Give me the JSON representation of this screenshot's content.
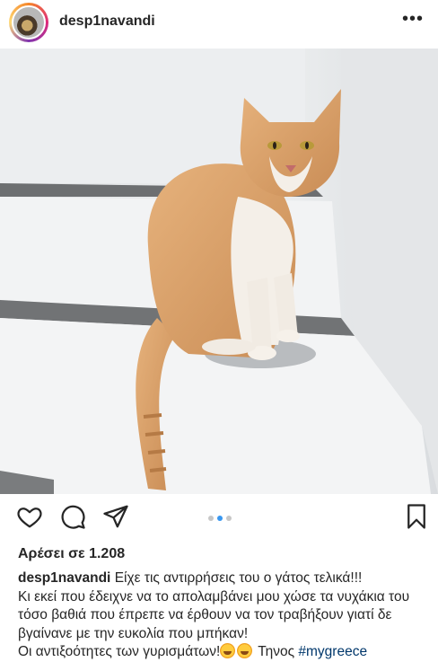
{
  "post": {
    "username": "desp1navandi",
    "more_icon_glyph": "•••",
    "likes_text": "Αρέσει σε 1.208",
    "carousel": {
      "count": 3,
      "active_index": 1
    },
    "caption": {
      "username": "desp1navandi",
      "line1": "Είχε τις αντιρρήσεις του ο γάτος τελικά!!!",
      "line2": "Κι εκεί που έδειχνε να το απολαμβάνει μου χώσε τα νυχάκια του τόσο βαθιά που έπρεπε να έρθουν να τον τραβήξουν γιατί δε βγαίνανε με την ευκολία που μπήκαν!",
      "line3_text": "Οι αντιξοότητες των γυρισμάτων!",
      "emoji": [
        "rofl-emoji",
        "rofl-emoji"
      ],
      "location_word": "Τηνος",
      "hashtag": "#mygreece"
    }
  },
  "icons": {
    "like": "heart-icon",
    "comment": "comment-icon",
    "share": "send-icon",
    "save": "bookmark-icon"
  },
  "colors": {
    "text": "#262626",
    "hashtag": "#00376b",
    "carousel_active": "#3897f0",
    "carousel_inactive": "#c7c7c7"
  }
}
